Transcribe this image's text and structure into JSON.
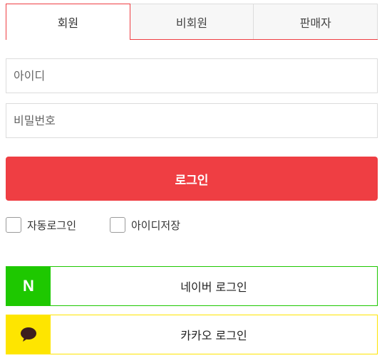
{
  "tabs": [
    {
      "label": "회원",
      "active": true
    },
    {
      "label": "비회원",
      "active": false
    },
    {
      "label": "판매자",
      "active": false
    }
  ],
  "form": {
    "id_placeholder": "아이디",
    "id_value": "",
    "pw_placeholder": "비밀번호",
    "pw_value": "",
    "login_label": "로그인",
    "auto_login_label": "자동로그인",
    "save_id_label": "아이디저장"
  },
  "social": {
    "naver": {
      "badge_letter": "N",
      "label": "네이버 로그인",
      "icon": "naver-n-icon"
    },
    "kakao": {
      "label": "카카오 로그인",
      "icon": "speech-bubble-icon"
    }
  },
  "colors": {
    "accent": "#ef3e43",
    "naver": "#1ec800",
    "kakao": "#fee500",
    "kakao_icon": "#3c1e1e"
  }
}
